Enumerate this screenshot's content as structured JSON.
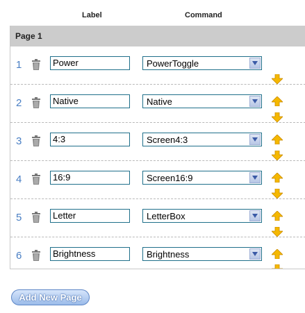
{
  "header": {
    "label_col": "Label",
    "command_col": "Command"
  },
  "page": {
    "title": "Page 1"
  },
  "rows": [
    {
      "num": "1",
      "label": "Power",
      "command": "PowerToggle"
    },
    {
      "num": "2",
      "label": "Native",
      "command": "Native"
    },
    {
      "num": "3",
      "label": "4:3",
      "command": "Screen4:3"
    },
    {
      "num": "4",
      "label": "16:9",
      "command": "Screen16:9"
    },
    {
      "num": "5",
      "label": "Letter",
      "command": "LetterBox"
    },
    {
      "num": "6",
      "label": "Brightness",
      "command": "Brightness"
    }
  ],
  "actions": {
    "add_page": "Add New Page"
  },
  "colors": {
    "row_number": "#4a7fc4",
    "arrow_fill": "#f5b800",
    "page_bar": "#cccccc"
  }
}
